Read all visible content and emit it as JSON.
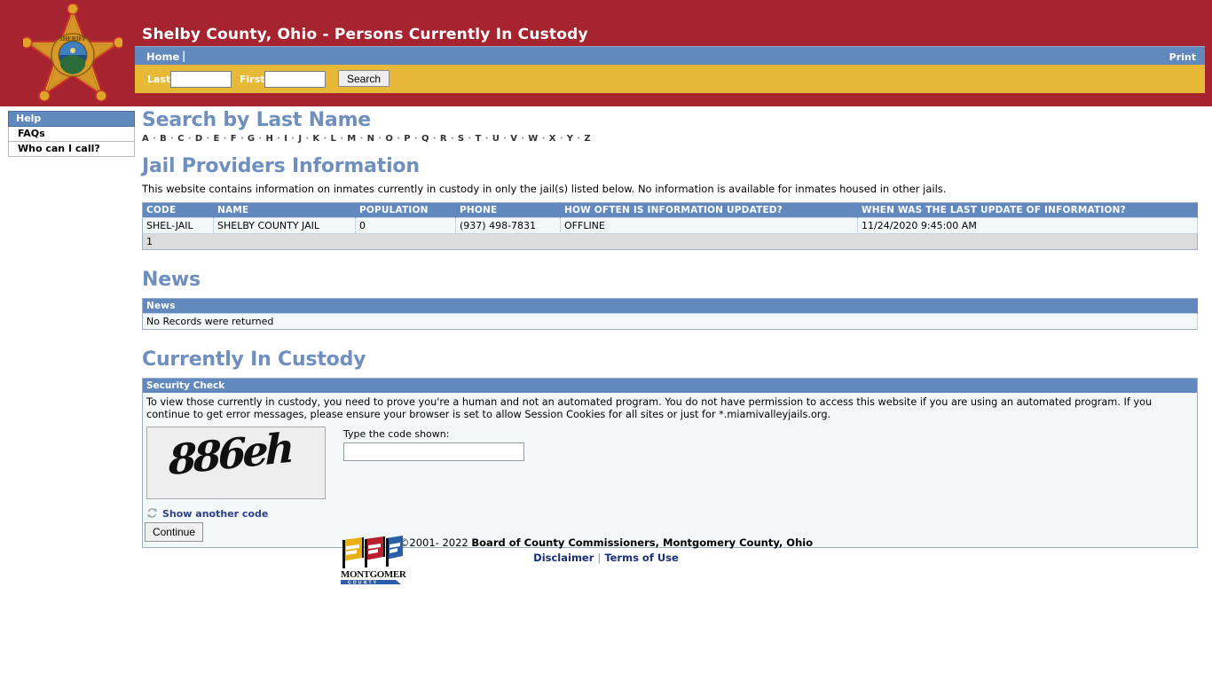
{
  "header": {
    "site_title": "Shelby County, Ohio - Persons Currently In Custody",
    "logo_alt": "sheriff-badge-icon",
    "nav": {
      "home_label": "Home",
      "separator": "|",
      "print_label": "Print"
    },
    "search": {
      "last_label": "Last",
      "last_value": "",
      "last_placeholder": "",
      "first_label": "First",
      "first_value": "",
      "first_placeholder": "",
      "button_label": "Search"
    },
    "colors": {
      "band": "#a52430",
      "nav": "#6189bd",
      "search_bar": "#e8b937"
    }
  },
  "sidebar": {
    "title": "Help",
    "items": [
      {
        "label": "FAQs"
      },
      {
        "label": "Who can I call?"
      }
    ]
  },
  "search_by_last_name": {
    "heading": "Search by Last Name",
    "letters": [
      "A",
      "B",
      "C",
      "D",
      "E",
      "F",
      "G",
      "H",
      "I",
      "J",
      "K",
      "L",
      "M",
      "N",
      "O",
      "P",
      "Q",
      "R",
      "S",
      "T",
      "U",
      "V",
      "W",
      "X",
      "Y",
      "Z"
    ]
  },
  "jail_providers": {
    "heading": "Jail Providers Information",
    "intro": "This website contains information on inmates currently in custody in only the jail(s) listed below. No information is available for inmates housed in other jails.",
    "columns": [
      "CODE",
      "NAME",
      "POPULATION",
      "PHONE",
      "HOW OFTEN IS INFORMATION UPDATED?",
      "WHEN WAS THE LAST UPDATE OF INFORMATION?"
    ],
    "rows": [
      {
        "code": "SHEL-JAIL",
        "name": "SHELBY COUNTY JAIL",
        "population": "0",
        "phone": "(937) 498-7831",
        "update_frequency": "OFFLINE",
        "last_update": "11/24/2020 9:45:00 AM"
      }
    ],
    "pager": "1"
  },
  "news": {
    "heading": "News",
    "column": "News",
    "empty_message": "No Records were returned"
  },
  "custody": {
    "heading": "Currently In Custody",
    "security": {
      "panel_title": "Security Check",
      "warning": "To view those currently in custody, you need to prove you're a human and not an automated program. You do not have permission to access this website if you are using an automated program. If you continue to get error messages, please ensure your browser is set to allow Session Cookies for all sites or just for *.miamivalleyjails.org.",
      "captcha_code": "886eh",
      "code_label": "Type the code shown:",
      "code_value": "",
      "code_placeholder": "",
      "refresh_label": "Show another code",
      "refresh_icon": "refresh-icon",
      "continue_label": "Continue"
    }
  },
  "footer": {
    "logo_alt": "montgomery-county-logo",
    "copyright_symbol": "©2001- 2022 ",
    "copyright_org": "Board of County Commissioners, Montgomery County, Ohio",
    "disclaimer_label": "Disclaimer",
    "pipe": "|",
    "terms_label": "Terms of Use"
  }
}
